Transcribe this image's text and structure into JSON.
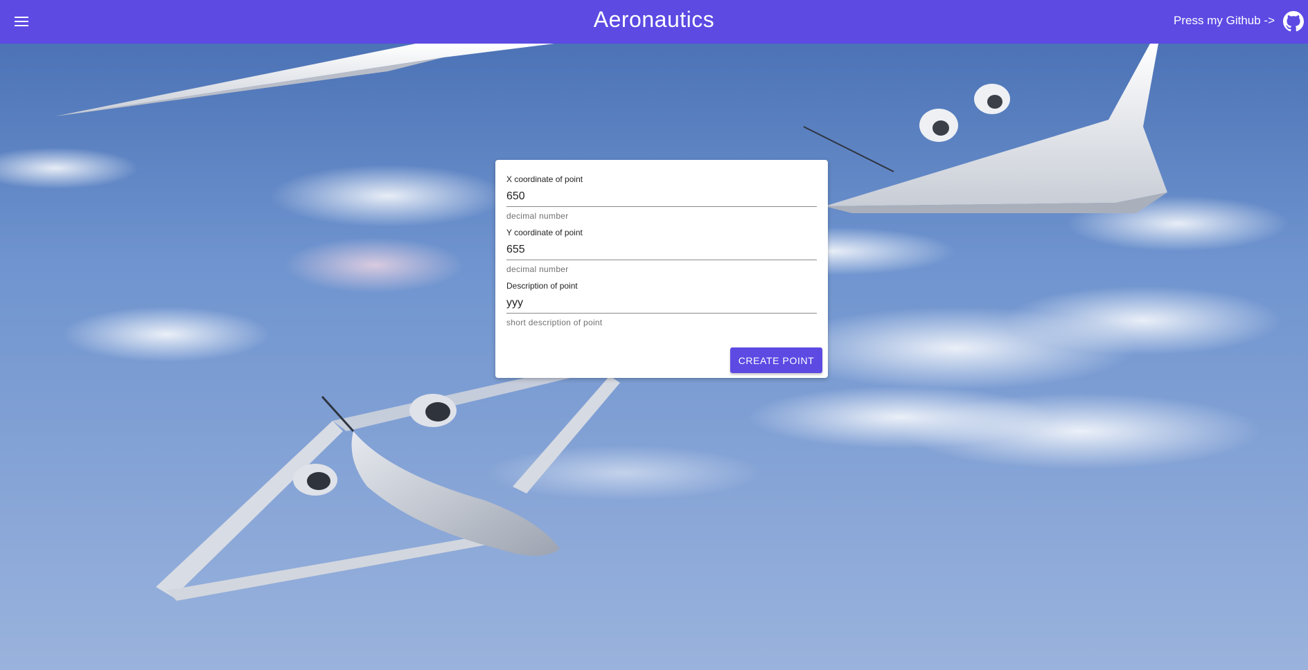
{
  "header": {
    "title": "Aeronautics",
    "github_label": "Press my Github ->",
    "menu_icon": "hamburger-menu-icon",
    "github_icon": "github-icon",
    "background_color": "#5c4ae3"
  },
  "form": {
    "x_field": {
      "label": "X coordinate of point",
      "value": "650",
      "hint": "decimal number"
    },
    "y_field": {
      "label": "Y coordinate of point",
      "value": "655",
      "hint": "decimal number"
    },
    "description_field": {
      "label": "Description of point",
      "value": "yyy",
      "hint": "short description of point"
    },
    "submit_label": "CREATE POINT"
  },
  "colors": {
    "accent": "#5c4ae3",
    "card": "#ffffff",
    "sky": "#6f93cf"
  }
}
